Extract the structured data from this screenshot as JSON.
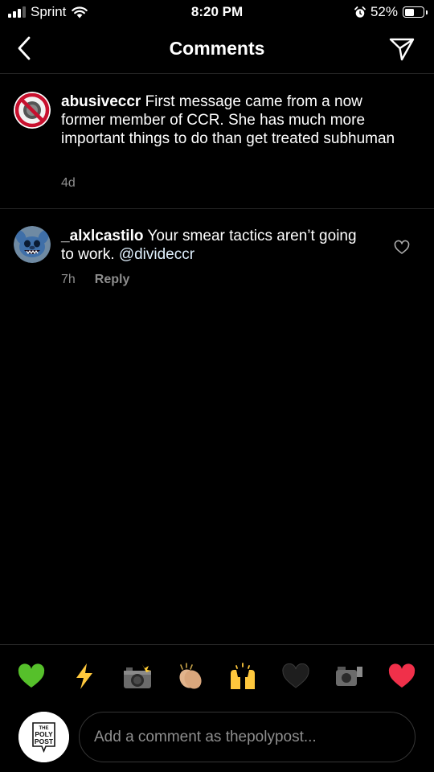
{
  "status_bar": {
    "carrier": "Sprint",
    "time": "8:20 PM",
    "battery": "52%",
    "battery_level": 0.52
  },
  "header": {
    "title": "Comments",
    "back_icon": "chevron-left-icon",
    "send_icon": "paper-plane-icon"
  },
  "caption": {
    "username": "abusiveccr",
    "text": "First message came from a now former member of CCR. She has much more important things to do than get treated subhuman",
    "time": "4d"
  },
  "comments": [
    {
      "username": "_alxlcastilo",
      "text": "Your smear tactics aren’t going to work.",
      "mention": "@divideccr",
      "time": "7h",
      "reply_label": "Reply"
    }
  ],
  "emoji_bar": [
    "💚",
    "⚡",
    "📸",
    "👏🏼",
    "🙌",
    "🖤",
    "📹",
    "❤️"
  ],
  "composer": {
    "placeholder": "Add a comment as thepolypost...",
    "avatar_lines": [
      "THE",
      "POLY",
      "POST"
    ]
  },
  "colors": {
    "background": "#000000",
    "secondary_text": "#8e8e8e",
    "divider": "#262626",
    "mention": "#e0f1ff"
  }
}
